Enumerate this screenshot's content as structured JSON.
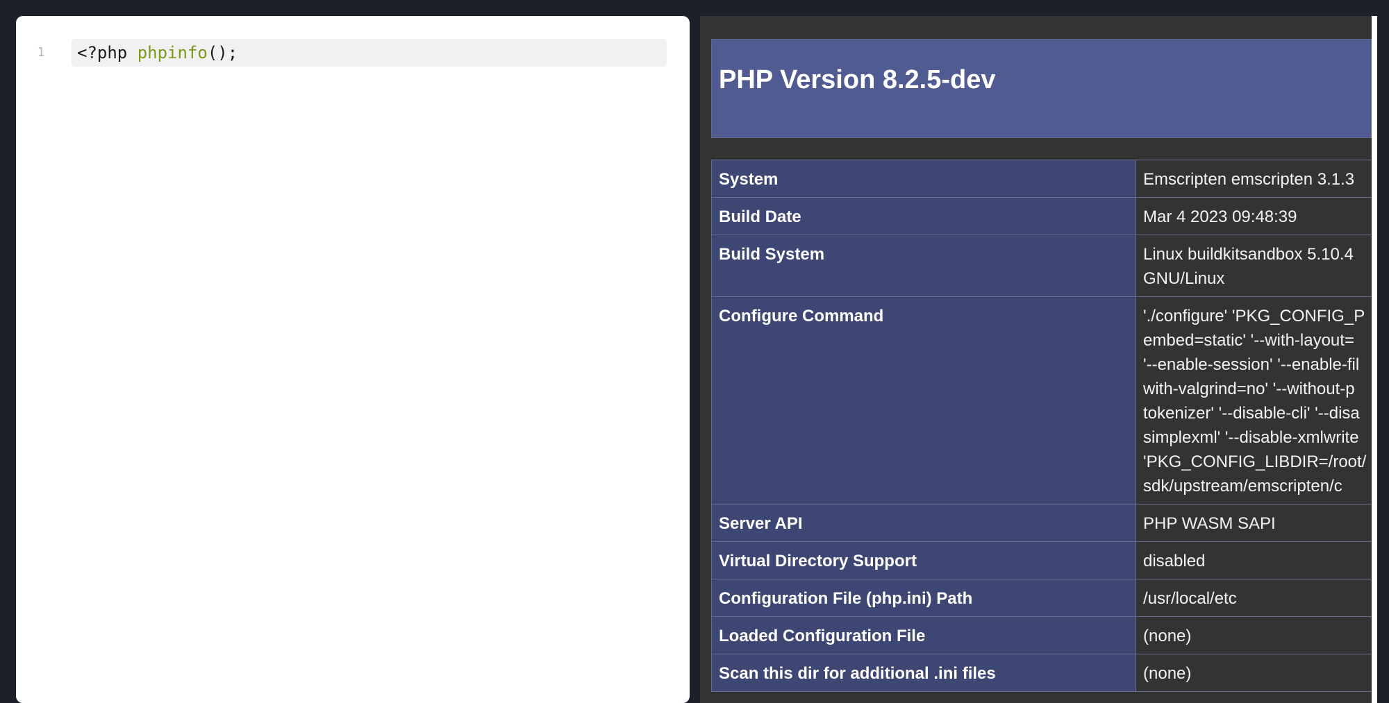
{
  "editor": {
    "line_number": "1",
    "code": {
      "open_tag": "<?php ",
      "function_name": "phpinfo",
      "call_rest": "();"
    },
    "colors": {
      "function": "#7c9a1a",
      "line_bg": "#f1f1f1"
    }
  },
  "output": {
    "title": "PHP Version 8.2.5-dev",
    "colors": {
      "header_bg": "#505b92",
      "key_bg": "#3e4673",
      "value_bg": "#333333"
    },
    "rows": [
      {
        "key": "System",
        "value": "Emscripten emscripten 3.1.3"
      },
      {
        "key": "Build Date",
        "value": "Mar 4 2023 09:48:39"
      },
      {
        "key": "Build System",
        "value_lines": [
          "Linux buildkitsandbox 5.10.4",
          "GNU/Linux"
        ]
      },
      {
        "key": "Configure Command",
        "value_lines": [
          "'./configure' 'PKG_CONFIG_P",
          "embed=static' '--with-layout=",
          "'--enable-session' '--enable-fil",
          "with-valgrind=no' '--without-p",
          "tokenizer' '--disable-cli' '--disa",
          "simplexml' '--disable-xmlwrite",
          "'PKG_CONFIG_LIBDIR=/root/",
          "sdk/upstream/emscripten/c"
        ]
      },
      {
        "key": "Server API",
        "value": "PHP WASM SAPI"
      },
      {
        "key": "Virtual Directory Support",
        "value": "disabled"
      },
      {
        "key": "Configuration File (php.ini) Path",
        "value": "/usr/local/etc"
      },
      {
        "key": "Loaded Configuration File",
        "value": "(none)"
      },
      {
        "key": "Scan this dir for additional .ini files",
        "value": "(none)"
      }
    ]
  }
}
